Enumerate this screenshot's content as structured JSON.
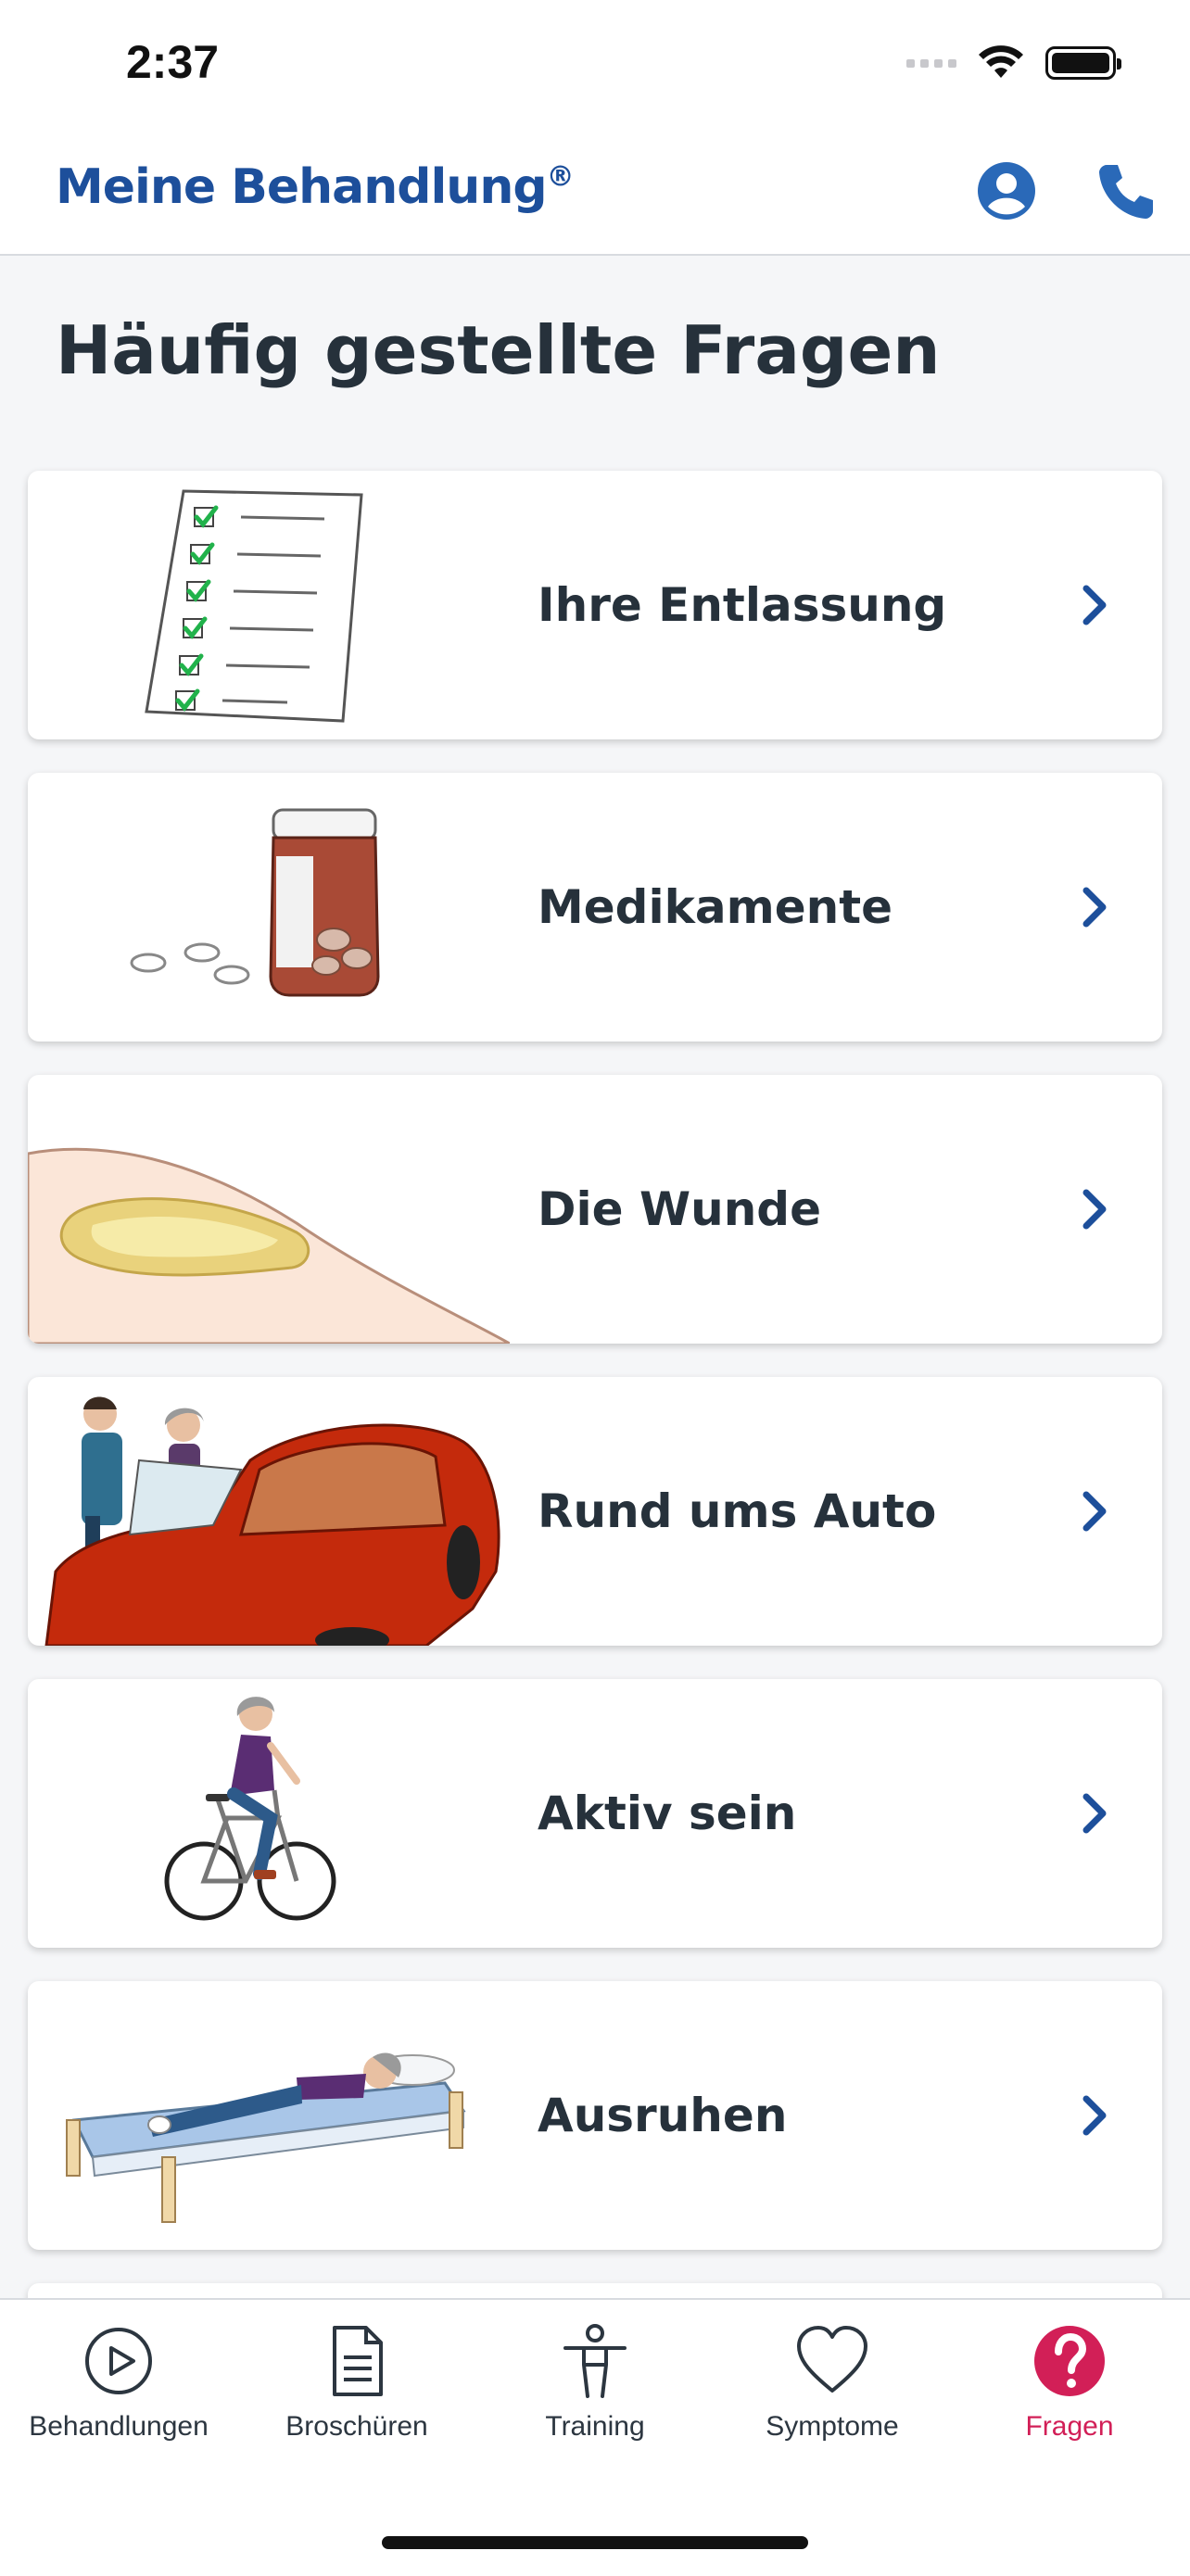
{
  "status_bar": {
    "time": "2:37"
  },
  "header": {
    "brand": "Meine Behandlung",
    "brand_mark": "®"
  },
  "page": {
    "title": "Häufig gestellte Fragen"
  },
  "cards": [
    {
      "label": "Ihre Entlassung",
      "icon": "checklist-illustration"
    },
    {
      "label": "Medikamente",
      "icon": "pill-jar-illustration"
    },
    {
      "label": "Die Wunde",
      "icon": "wound-bandage-illustration"
    },
    {
      "label": "Rund ums Auto",
      "icon": "car-illustration"
    },
    {
      "label": "Aktiv sein",
      "icon": "cycling-illustration"
    },
    {
      "label": "Ausruhen",
      "icon": "resting-bed-illustration"
    }
  ],
  "tabbar": {
    "items": [
      {
        "label": "Behandlungen",
        "icon": "play-circle-icon"
      },
      {
        "label": "Broschüren",
        "icon": "document-icon"
      },
      {
        "label": "Training",
        "icon": "person-icon"
      },
      {
        "label": "Symptome",
        "icon": "heart-icon"
      },
      {
        "label": "Fragen",
        "icon": "question-circle-icon",
        "active": true
      }
    ]
  },
  "colors": {
    "brand": "#1d4f9b",
    "active_tab": "#d21f57",
    "text": "#26313b"
  }
}
